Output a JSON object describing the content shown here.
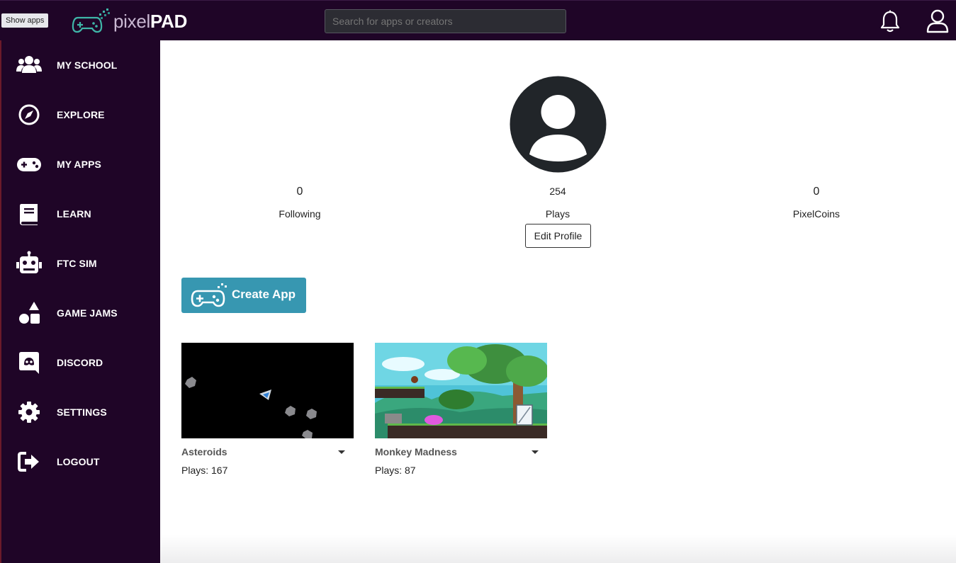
{
  "tooltip": "Show apps",
  "brand": {
    "light": "pixel",
    "bold": "PAD"
  },
  "search": {
    "placeholder": "Search for apps or creators"
  },
  "sidebar": {
    "items": [
      {
        "label": "MY SCHOOL",
        "icon": "users-icon"
      },
      {
        "label": "EXPLORE",
        "icon": "compass-icon"
      },
      {
        "label": "MY APPS",
        "icon": "gamepad-icon"
      },
      {
        "label": "LEARN",
        "icon": "book-icon"
      },
      {
        "label": "FTC SIM",
        "icon": "robot-icon"
      },
      {
        "label": "GAME JAMS",
        "icon": "shapes-icon"
      },
      {
        "label": "DISCORD",
        "icon": "discord-icon"
      },
      {
        "label": "SETTINGS",
        "icon": "gear-icon"
      },
      {
        "label": "LOGOUT",
        "icon": "logout-icon"
      }
    ]
  },
  "profile": {
    "following": {
      "value": "0",
      "label": "Following"
    },
    "plays": {
      "value": "254",
      "label": "Plays"
    },
    "pixelcoins": {
      "value": "0",
      "label": "PixelCoins"
    },
    "edit_label": "Edit Profile"
  },
  "create_app_label": "Create App",
  "apps": [
    {
      "title": "Asteroids",
      "plays": "Plays: 167"
    },
    {
      "title": "Monkey Madness",
      "plays": "Plays: 87"
    }
  ],
  "colors": {
    "nav_bg": "#1f0527",
    "accent": "#3797b1"
  }
}
